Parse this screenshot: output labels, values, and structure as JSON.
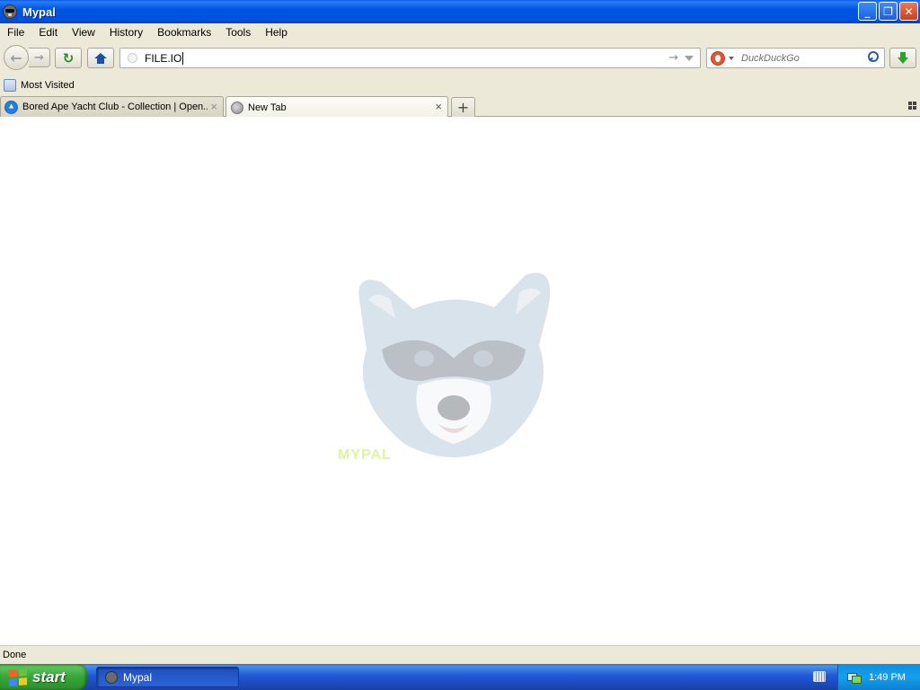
{
  "window": {
    "title": "Mypal",
    "controls": {
      "minimize": "_",
      "restore": "❐",
      "close": "✕"
    }
  },
  "menu": [
    "File",
    "Edit",
    "View",
    "History",
    "Bookmarks",
    "Tools",
    "Help"
  ],
  "toolbar": {
    "back_glyph": "←",
    "forward_glyph": "→",
    "reload_glyph": "↻",
    "url_value": "FILE.IO",
    "go_glyph": "→",
    "search_engine": "duckduckgo-icon",
    "search_placeholder": "DuckDuckGo"
  },
  "bookmarks": {
    "most_visited": "Most Visited"
  },
  "tabs": [
    {
      "label": "Bored Ape Yacht Club - Collection | Open...",
      "icon": "opensea-icon",
      "active": false,
      "close": "×"
    },
    {
      "label": "New Tab",
      "icon": "globe-icon",
      "active": true,
      "close": "×"
    }
  ],
  "new_tab_glyph": "+",
  "content": {
    "mascot": "raccoon-logo",
    "mascot_caption": "MYPAL"
  },
  "status": {
    "text": "Done"
  },
  "taskbar": {
    "start_label": "start",
    "task": "Mypal",
    "clock": "1:49 PM"
  },
  "colors": {
    "titlebar": "#0054e3",
    "chrome": "#ece9d8",
    "start_green": "#37a637",
    "taskbar_blue": "#2157d7",
    "tray_blue": "#14a0ec"
  }
}
